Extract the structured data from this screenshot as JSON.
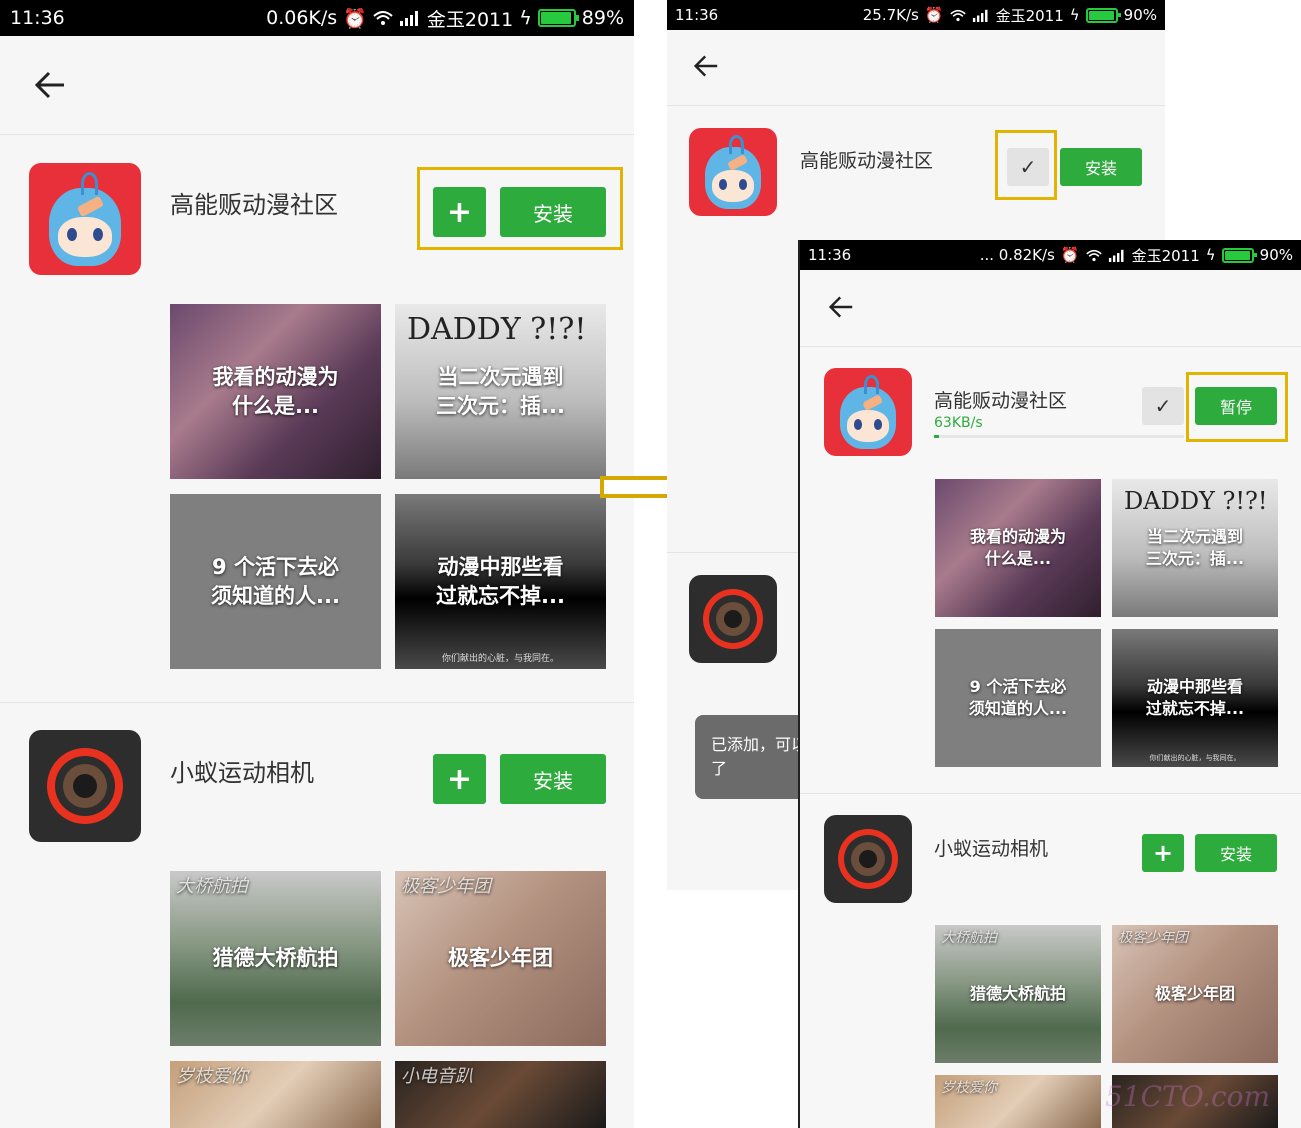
{
  "colors": {
    "accent_green": "#2eab3d",
    "highlight": "#e0b400",
    "status_bar": "#000000",
    "battery": "#27c93f"
  },
  "screen1": {
    "status": {
      "time": "11:36",
      "speed": "0.06K/s",
      "carrier": "金玉2011",
      "battery": "89%"
    },
    "apps": [
      {
        "name": "高能贩动漫社区",
        "icon": "anime-girl-icon",
        "plus": "+",
        "install": "安装",
        "tiles": [
          {
            "text": "我看的动漫为\n什么是..."
          },
          {
            "text": "当二次元遇到\n三次元：插...",
            "deco": "DADDY ?!?!"
          },
          {
            "text": "9 个活下去必\n须知道的人..."
          },
          {
            "text": "动漫中那些看\n过就忘不掉...",
            "caption": "你们献出的心脏，与我同在。"
          }
        ]
      },
      {
        "name": "小蚁运动相机",
        "icon": "camera-lens-icon",
        "plus": "+",
        "install": "安装",
        "tiles": [
          {
            "text": "猎德大桥航拍",
            "deco": "大桥航拍"
          },
          {
            "text": "极客少年团",
            "deco": "极客少年团"
          },
          {
            "text": "",
            "deco": "岁枝爱你"
          },
          {
            "text": "",
            "deco": "小电音趴"
          }
        ]
      }
    ]
  },
  "screen2": {
    "status": {
      "time": "11:36",
      "speed": "25.7K/s",
      "carrier": "金玉2011",
      "battery": "90%"
    },
    "app": {
      "name": "高能贩动漫社区",
      "check": "✓",
      "install": "安装"
    },
    "toast": "已添加，可以\n了"
  },
  "screen3": {
    "status": {
      "time": "11:36",
      "speed": "... 0.82K/s",
      "carrier": "金玉2011",
      "battery": "90%"
    },
    "apps": [
      {
        "name": "高能贩动漫社区",
        "download_speed": "63KB/s",
        "progress": 0.02,
        "check": "✓",
        "pause": "暂停",
        "tiles": [
          {
            "text": "我看的动漫为\n什么是..."
          },
          {
            "text": "当二次元遇到\n三次元：插...",
            "deco": "DADDY ?!?!"
          },
          {
            "text": "9 个活下去必\n须知道的人..."
          },
          {
            "text": "动漫中那些看\n过就忘不掉...",
            "caption": "你们献出的心脏，与我同在。"
          }
        ]
      },
      {
        "name": "小蚁运动相机",
        "plus": "+",
        "install": "安装",
        "tiles": [
          {
            "text": "猎德大桥航拍",
            "deco": "大桥航拍"
          },
          {
            "text": "极客少年团",
            "deco": "极客少年团"
          },
          {
            "text": "",
            "deco": "岁枝爱你"
          },
          {
            "text": "",
            "deco": ""
          }
        ]
      }
    ]
  },
  "watermark": "51CTO.com"
}
